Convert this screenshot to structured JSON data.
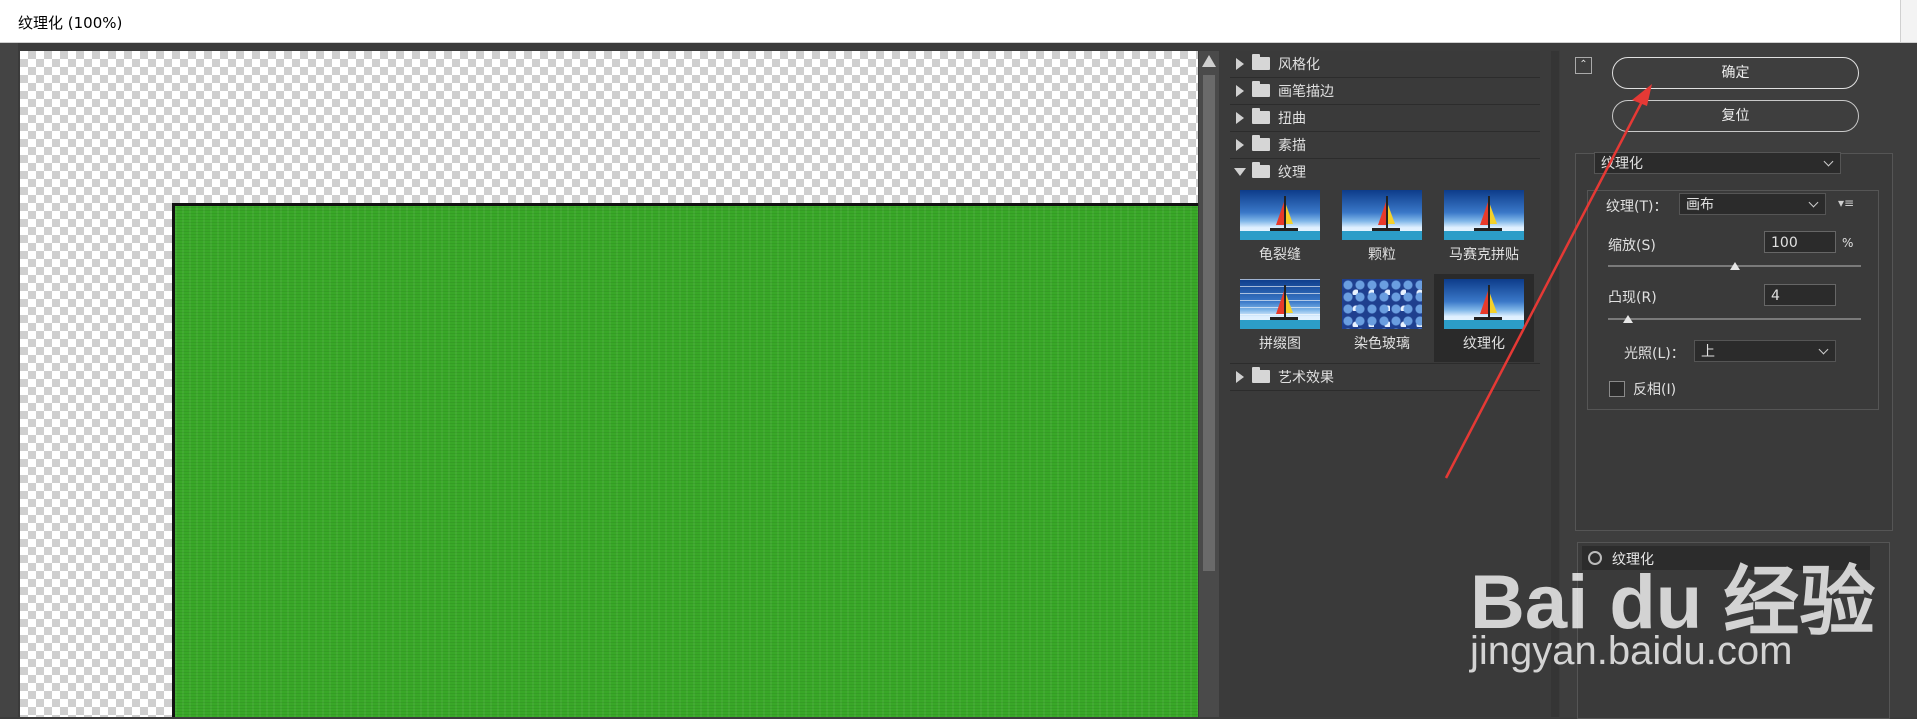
{
  "window": {
    "title": "纹理化 (100%)"
  },
  "gallery": {
    "categories_top": [
      "风格化",
      "画笔描边",
      "扭曲",
      "素描"
    ],
    "open_category": "纹理",
    "thumbnails": [
      {
        "label": "龟裂缝",
        "selected": false
      },
      {
        "label": "颗粒",
        "selected": false
      },
      {
        "label": "马赛克拼贴",
        "selected": false
      },
      {
        "label": "拼缀图",
        "selected": false
      },
      {
        "label": "染色玻璃",
        "selected": false
      },
      {
        "label": "纹理化",
        "selected": true
      }
    ],
    "categories_bottom": [
      "艺术效果"
    ]
  },
  "controls": {
    "collapse_icon": "collapse-up-icon",
    "ok_label": "确定",
    "reset_label": "复位",
    "filter_select": "纹理化",
    "texture_label": "纹理(T)：",
    "texture_value": "画布",
    "scale_label": "缩放(S)",
    "scale_value": "100",
    "scale_unit": "%",
    "scale_slider": 0.5,
    "relief_label": "凸现(R)",
    "relief_value": "4",
    "relief_slider": 0.08,
    "light_label": "光照(L)：",
    "light_value": "上",
    "invert_label": "反相(I)",
    "invert_checked": false
  },
  "layers": {
    "items": [
      {
        "label": "纹理化"
      }
    ]
  },
  "watermark": {
    "brand": "Bai du 经验",
    "url": "jingyan.baidu.com"
  },
  "colors": {
    "accent_arrow": "#e53935",
    "canvas_fill": "#39a828"
  }
}
